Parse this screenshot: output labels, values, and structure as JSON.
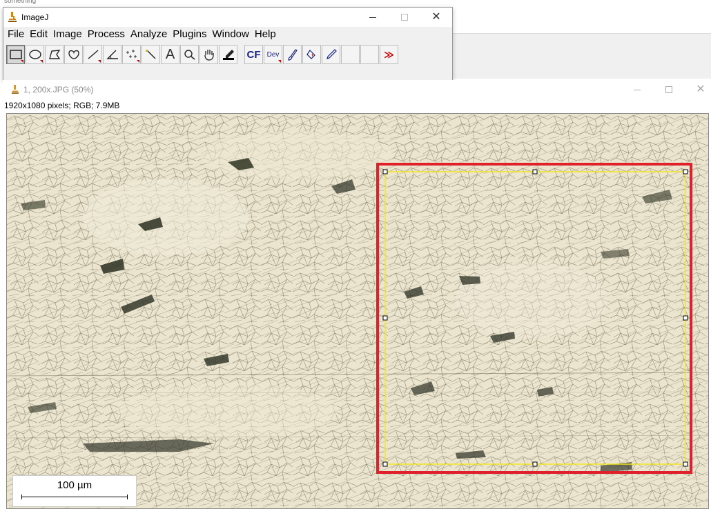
{
  "background_app": {
    "cutoff_text": "something"
  },
  "imagej": {
    "title": "ImageJ",
    "menu": [
      "File",
      "Edit",
      "Image",
      "Process",
      "Analyze",
      "Plugins",
      "Window",
      "Help"
    ],
    "tools": [
      {
        "icon": "rectangle-icon",
        "selected": true
      },
      {
        "icon": "oval-icon"
      },
      {
        "icon": "polygon-icon"
      },
      {
        "icon": "freehand-icon"
      },
      {
        "icon": "line-icon"
      },
      {
        "icon": "angle-icon"
      },
      {
        "icon": "point-icon"
      },
      {
        "icon": "wand-icon"
      },
      {
        "icon": "text-icon",
        "label": "A"
      },
      {
        "icon": "magnifier-icon"
      },
      {
        "icon": "hand-icon"
      },
      {
        "icon": "dropper-icon"
      },
      {
        "icon": "cf-icon",
        "label": "CF"
      },
      {
        "icon": "dev-icon",
        "label": "Dev"
      },
      {
        "icon": "brush-icon"
      },
      {
        "icon": "flood-icon"
      },
      {
        "icon": "pencil-icon"
      },
      {
        "icon": "blank-icon"
      },
      {
        "icon": "blank-icon"
      },
      {
        "icon": "more-tools-icon",
        "label": "≫"
      }
    ]
  },
  "image_window": {
    "title": "1, 200x.JPG (50%)",
    "info": "1920x1080 pixels; RGB; 7.9MB",
    "scalebar_label": "100 µm",
    "highlight_color": "#e0202a",
    "selection_color": "#f5e61a"
  }
}
